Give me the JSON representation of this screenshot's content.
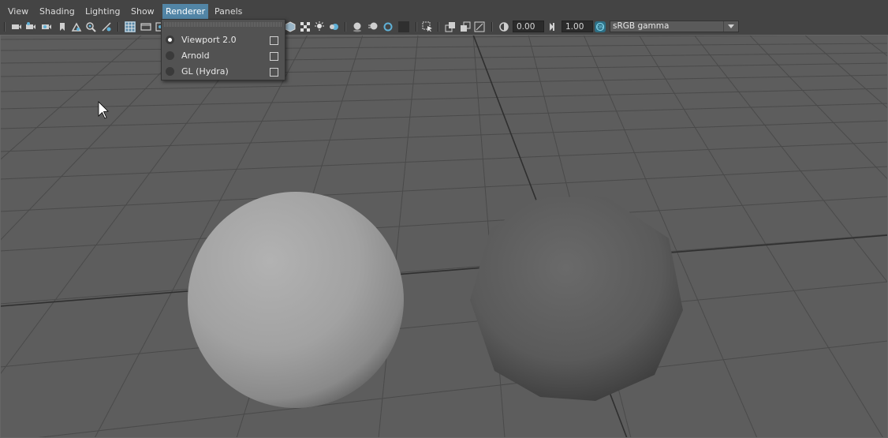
{
  "menu": {
    "view": "View",
    "shading": "Shading",
    "lighting": "Lighting",
    "show": "Show",
    "renderer": "Renderer",
    "panels": "Panels"
  },
  "toolbar": {
    "exposure_value": "0.00",
    "gamma_value": "1.00",
    "color_space": "sRGB gamma",
    "icons": [
      "camera-icon",
      "camera-attributes-icon",
      "bookmark-icon",
      "image-plane-icon",
      "grease-pencil-icon",
      "two-d-pan-icon",
      "grid-icon",
      "film-gate-icon",
      "resolution-gate-icon",
      "textured-icon",
      "lights-icon",
      "shadows-icon",
      "ambient-occlusion-icon",
      "isolate-select-icon",
      "xray-icon",
      "wireframe-shaded-icon",
      "exposure-icon",
      "gamma-icon",
      "color-management-icon"
    ]
  },
  "renderer_menu": {
    "items": [
      {
        "label": "Viewport 2.0",
        "selected": true
      },
      {
        "label": "Arnold",
        "selected": false
      },
      {
        "label": "GL (Hydra)",
        "selected": false
      }
    ]
  },
  "colors": {
    "highlight": "#5285a6",
    "background": "#444444",
    "viewport_bg": "#5a5a5a"
  }
}
